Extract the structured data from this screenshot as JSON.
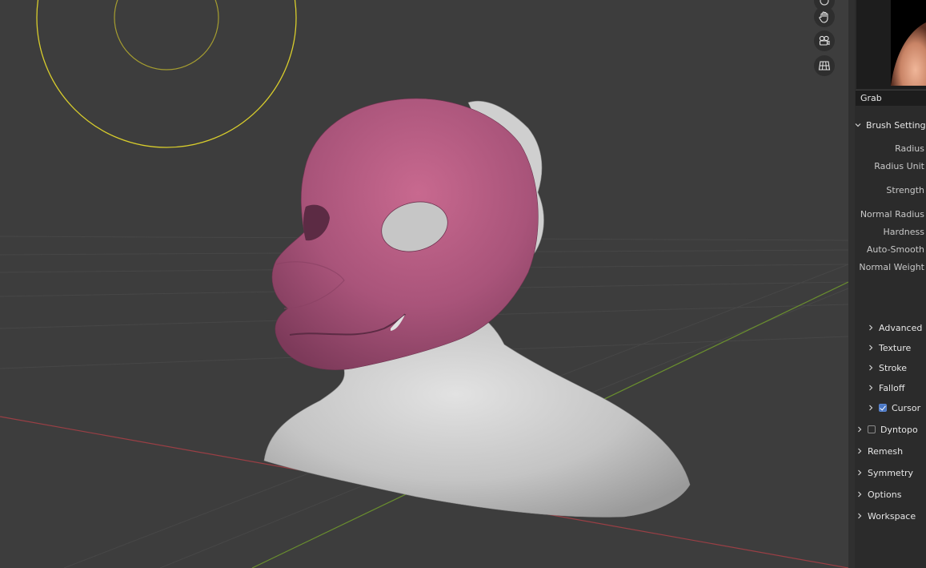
{
  "colors": {
    "viewport_bg": "#3d3d3d",
    "cursor_ring": "#d8cd2c",
    "mask_color": "#b0587a",
    "mesh_color": "#c9c9c9",
    "x_axis": "#9a3f45",
    "y_axis": "#6a8f2e",
    "accent": "#4a77c4"
  },
  "viewport": {
    "nav_icons": [
      "hand-pan-icon",
      "camera-icon",
      "grid-view-icon"
    ]
  },
  "brush": {
    "name": "Grab"
  },
  "brush_settings": {
    "header": "Brush Settings",
    "properties": [
      "Radius",
      "Radius Unit",
      "Strength",
      "Normal Radius",
      "Hardness",
      "Auto-Smooth",
      "Normal Weight"
    ]
  },
  "subpanels": [
    {
      "label": "Advanced"
    },
    {
      "label": "Texture"
    },
    {
      "label": "Stroke"
    },
    {
      "label": "Falloff"
    },
    {
      "label": "Cursor",
      "checked": true
    }
  ],
  "panels": [
    {
      "label": "Dyntopo",
      "checked": false
    },
    {
      "label": "Remesh"
    },
    {
      "label": "Symmetry"
    },
    {
      "label": "Options"
    },
    {
      "label": "Workspace"
    }
  ]
}
